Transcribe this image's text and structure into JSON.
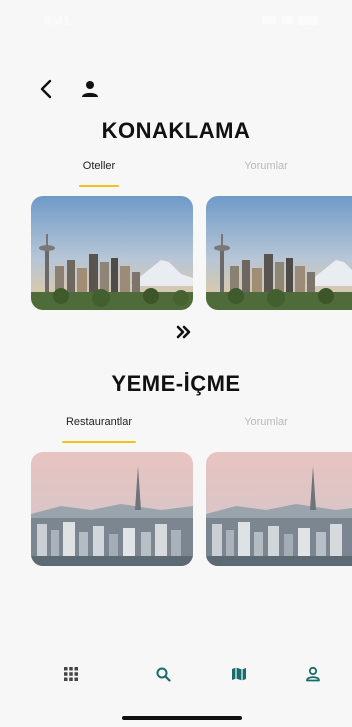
{
  "status_bar": {
    "time": "9:41"
  },
  "header": {
    "back_icon": "chevron-left-icon",
    "profile_icon": "person-icon"
  },
  "accommodation": {
    "title": "KONAKLAMA",
    "tabs": [
      {
        "label": "Oteller",
        "active": true
      },
      {
        "label": "Yorumlar",
        "active": false
      }
    ],
    "cards": [
      {
        "image": "seattle-skyline"
      },
      {
        "image": "seattle-skyline"
      }
    ]
  },
  "more_icon": "double-chevron-right-icon",
  "food": {
    "title": "YEME-İÇME",
    "tabs": [
      {
        "label": "Restaurantlar",
        "active": true
      },
      {
        "label": "Yorumlar",
        "active": false
      }
    ],
    "cards": [
      {
        "image": "seoul-skyline"
      },
      {
        "image": "seoul-skyline"
      }
    ]
  },
  "bottom_nav": [
    {
      "icon": "grid-icon"
    },
    {
      "icon": "search-icon"
    },
    {
      "icon": "map-icon"
    },
    {
      "icon": "user-icon"
    }
  ],
  "colors": {
    "accent": "#f0c419",
    "nav_icon": "#1a6b6b",
    "inactive_tab": "#b9b9b9"
  }
}
